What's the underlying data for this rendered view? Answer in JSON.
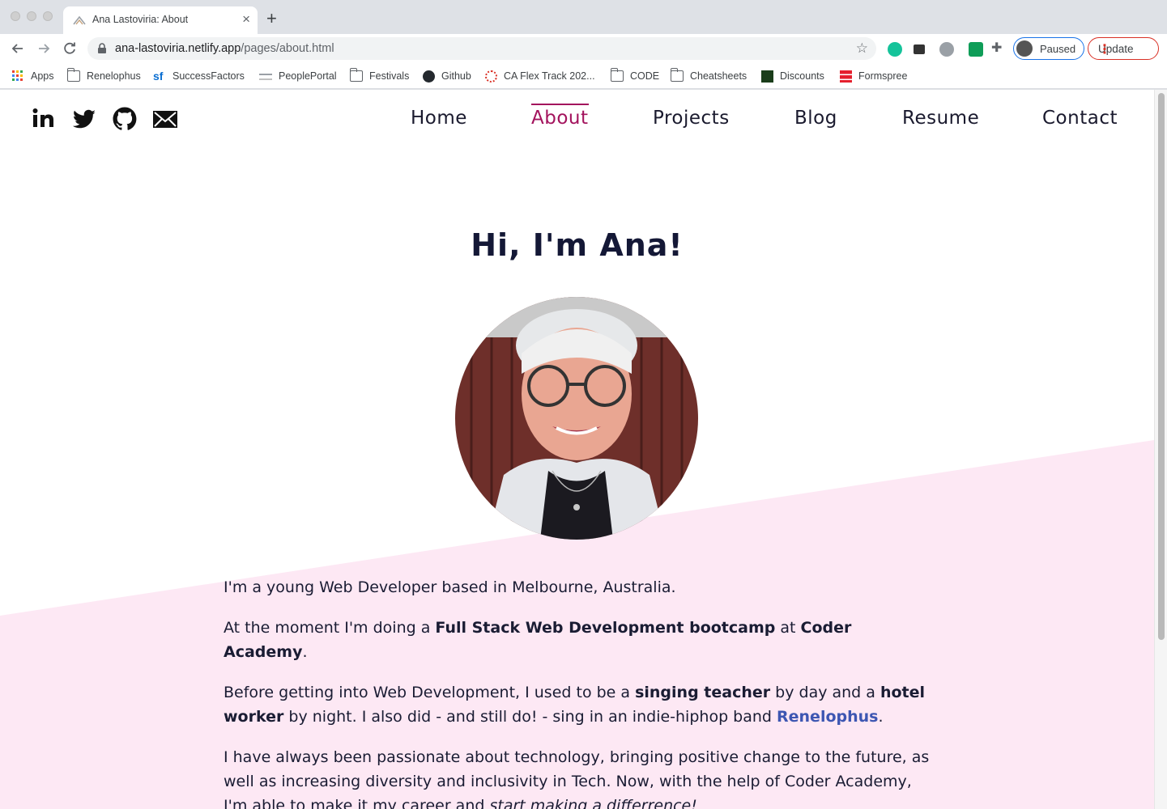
{
  "browser": {
    "tab_title": "Ana Lastoviria: About",
    "url_host": "ana-lastoviria.netlify.app",
    "url_path": "/pages/about.html",
    "profile_label": "Paused",
    "update_label": "Update",
    "bookmarks": [
      "Apps",
      "Renelophus",
      "SuccessFactors",
      "PeoplePortal",
      "Festivals",
      "Github",
      "CA Flex Track 202...",
      "CODE",
      "Cheatsheets",
      "Discounts",
      "Formspree"
    ]
  },
  "header": {
    "nav": [
      "Home",
      "About",
      "Projects",
      "Blog",
      "Resume",
      "Contact"
    ],
    "active_nav": "About"
  },
  "main": {
    "title": "Hi, I'm Ana!",
    "p1": "I'm a young Web Developer based in Melbourne, Australia.",
    "p2_a": "At the moment I'm doing a ",
    "p2_b": "Full Stack Web Development bootcamp",
    "p2_c": " at ",
    "p2_d": "Coder Academy",
    "p2_e": ".",
    "p3_a": "Before getting into Web Development, I used to be a ",
    "p3_b": "singing teacher",
    "p3_c": " by day and a ",
    "p3_d": "hotel worker",
    "p3_e": " by night. I also did - and still do! - sing in an indie-hiphop band ",
    "p3_link": "Renelophus",
    "p3_f": ".",
    "p4_a": "I have always been passionate about technology, bringing positive change to the future, as well as increasing diversity and inclusivity in Tech. Now, with the help of Coder Academy, I'm able to make it my career and ",
    "p4_b": "start making a differrence!"
  },
  "colors": {
    "accent": "#a3135d",
    "text": "#1a1c33",
    "link": "#3d56b2",
    "pink_bg": "#fde8f4"
  }
}
